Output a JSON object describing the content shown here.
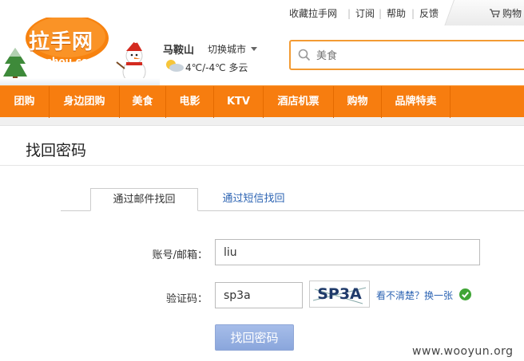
{
  "topbar": {
    "links": [
      "收藏拉手网",
      "订阅",
      "帮助",
      "反馈"
    ],
    "cart_label": "购物"
  },
  "logo": {
    "text": "拉手网",
    "subtext": "Lashou.com"
  },
  "location": {
    "city": "马鞍山",
    "switch_label": "切换城市",
    "weather": "4℃/-4℃ 多云"
  },
  "search": {
    "placeholder": "美食"
  },
  "nav": {
    "items": [
      "团购",
      "身边团购",
      "美食",
      "电影",
      "KTV",
      "酒店机票",
      "购物",
      "品牌特卖"
    ]
  },
  "page": {
    "title": "找回密码",
    "tabs": [
      {
        "label": "通过邮件找回",
        "active": true
      },
      {
        "label": "通过短信找回",
        "active": false
      }
    ],
    "form": {
      "account_label": "账号/邮箱：",
      "account_value": "liu",
      "captcha_label": "验证码：",
      "captcha_value": "sp3a",
      "captcha_image_text": "SP3A",
      "refresh_label": "看不清楚？换一张",
      "submit_label": "找回密码"
    }
  },
  "watermark": "www.wooyun.org",
  "colors": {
    "accent": "#f77d0f",
    "link": "#2d64b3",
    "submit": "#9ab3e4"
  }
}
